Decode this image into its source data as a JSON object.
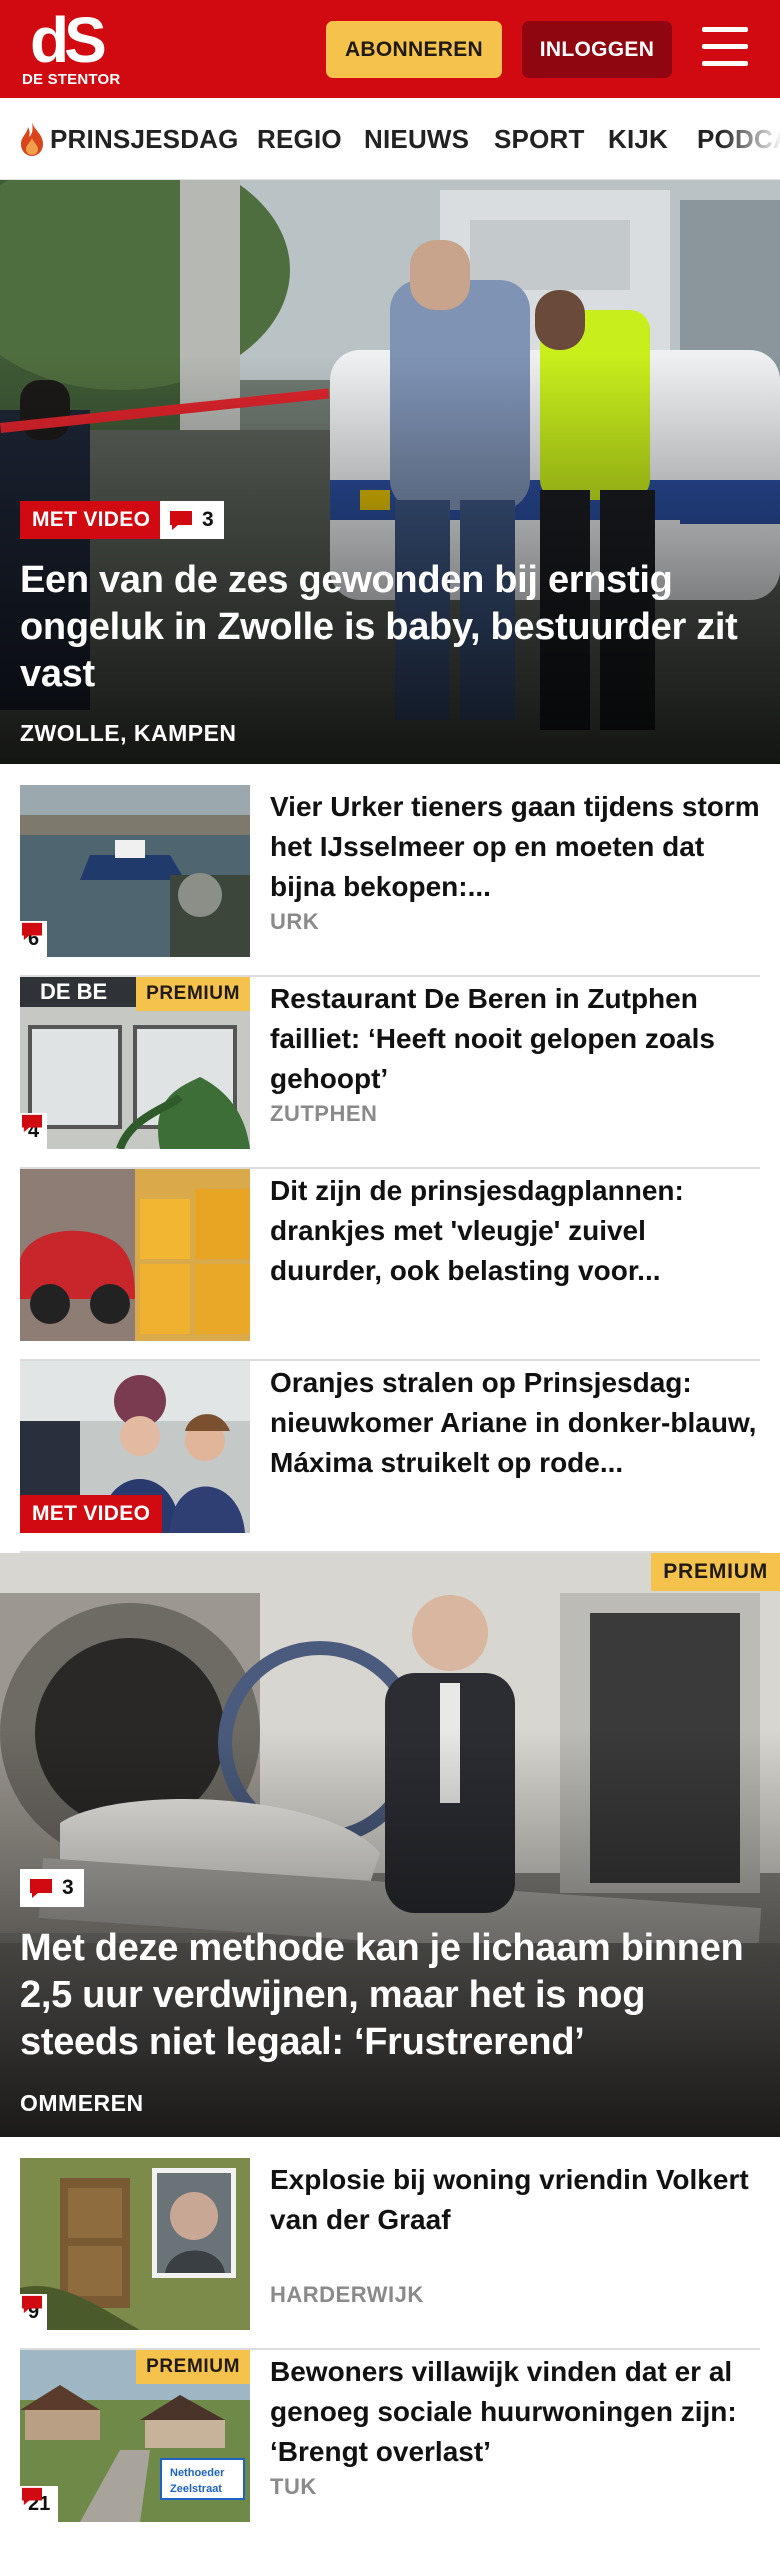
{
  "header": {
    "logo_mark": "dS",
    "logo_sub": "DE STENTOR",
    "subscribe_label": "ABONNEREN",
    "login_label": "INLOGGEN",
    "menu_icon": "hamburger-icon",
    "brand_color": "#d10a11"
  },
  "nav": {
    "items": [
      {
        "label": "PRINSJESDAG",
        "icon": "flame-icon"
      },
      {
        "label": "REGIO"
      },
      {
        "label": "NIEUWS"
      },
      {
        "label": "SPORT"
      },
      {
        "label": "KIJK"
      },
      {
        "label": "PODCA"
      }
    ]
  },
  "hero1": {
    "video_label": "MET VIDEO",
    "comments": "3",
    "title": "Een van de zes gewonden bij ernstig ongeluk in Zwolle is baby, bestuurder zit vast",
    "location": "ZWOLLE, KAMPEN",
    "image": "politie-arrestatie"
  },
  "list1": [
    {
      "title": "Vier Urker tieners gaan tijdens storm het IJsselmeer op en moeten dat bijna bekopen:...",
      "location": "URK",
      "comments": "6"
    },
    {
      "title": "Restaurant De Beren in Zutphen failliet: ‘Heeft nooit gelopen zoals gehoopt’",
      "location": "ZUTPHEN",
      "comments": "4",
      "premium_label": "PREMIUM",
      "thumb_sign": "DE BE"
    },
    {
      "title": "Dit zijn de prinsjesdagplannen: drankjes met 'vleugje' zuivel duurder, ook belasting voor...",
      "location": ""
    },
    {
      "title": "Oranjes stralen op Prinsjesdag: nieuwkomer Ariane in donker-blauw, Máxima struikelt op rode...",
      "location": "",
      "video_label": "MET VIDEO"
    }
  ],
  "hero2": {
    "premium_label": "PREMIUM",
    "comments": "3",
    "title": "Met deze methode kan je lichaam binnen 2,5 uur verdwijnen, maar het is nog steeds niet legaal: ‘Frustrerend’",
    "location": "OMMEREN",
    "image": "resomator"
  },
  "list2": [
    {
      "title": "Explosie bij woning vriendin Volkert van der Graaf",
      "location": "HARDERWIJK",
      "comments": "9"
    },
    {
      "title": "Bewoners villawijk vinden dat er al genoeg sociale huurwoningen zijn: ‘Brengt overlast’",
      "location": "TUK",
      "comments": "21",
      "premium_label": "PREMIUM",
      "sign_line1": "Nethoeder",
      "sign_line2": "Zeelstraat"
    }
  ]
}
